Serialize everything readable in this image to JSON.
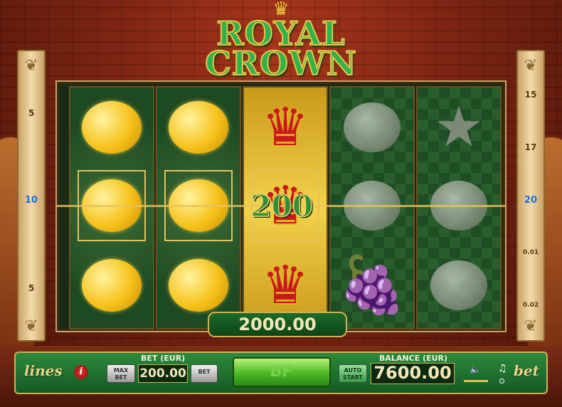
{
  "game": {
    "logo_line1": "ROYAL",
    "logo_line2": "CROWN"
  },
  "left_lines": [
    "5",
    "10",
    "5"
  ],
  "right_lines": [
    "15",
    "17",
    "20",
    "0.01",
    "0.02"
  ],
  "reels": [
    [
      "lemon",
      "lemon",
      "lemon"
    ],
    [
      "lemon",
      "lemon",
      "lemon"
    ],
    [
      "crown",
      "crown",
      "crown"
    ],
    [
      "orange",
      "orange",
      "grapes"
    ],
    [
      "star",
      "lemon",
      "lemon"
    ]
  ],
  "line_win": "200",
  "total_win": "2000.00",
  "controls": {
    "lines_label": "lines",
    "info_label": "i",
    "max_bet_label": "MAX BET",
    "bet_label": "BET (EUR)",
    "bet_value": "200.00",
    "bet_button_label": "BET",
    "spin_label": "BF",
    "auto_start_label": "AUTO START",
    "balance_label": "BALANCE (EUR)",
    "balance_value": "7600.00",
    "bet_side_label": "bet"
  },
  "colors": {
    "panel_green": "#145a22",
    "accent_gold": "#d4b054",
    "highlight_blue": "#1f6fd8"
  }
}
